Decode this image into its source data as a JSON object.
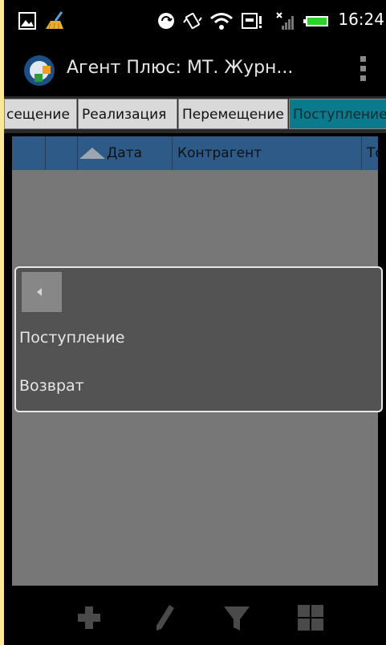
{
  "status_bar": {
    "time": "16:24",
    "icons": [
      "picture-icon",
      "broom-icon",
      "sync-icon",
      "vibrate-icon",
      "wifi-icon",
      "sd-alert-icon",
      "no-signal-icon",
      "battery-icon"
    ]
  },
  "action_bar": {
    "title": "Агент Плюс: МТ. Журн...",
    "overflow_icon": "overflow-menu-icon"
  },
  "tabs": [
    {
      "label": "сещение",
      "active": false
    },
    {
      "label": "Реализация",
      "active": false
    },
    {
      "label": "Перемещение",
      "active": false
    },
    {
      "label": "Поступление",
      "active": true
    }
  ],
  "table": {
    "columns": [
      "",
      "",
      "Дата",
      "Контрагент",
      "То"
    ],
    "sort_icon": "sort-ascending-icon"
  },
  "dialog": {
    "back_icon": "back-arrow-icon",
    "items": [
      "Поступление",
      "Возврат"
    ]
  },
  "bottom_bar": {
    "icons": [
      "add-icon",
      "edit-icon",
      "filter-icon",
      "grid-icon"
    ]
  },
  "colors": {
    "accent_tab": "#0b7a8c",
    "header": "#2d5a86",
    "dialog_bg": "#535353"
  }
}
